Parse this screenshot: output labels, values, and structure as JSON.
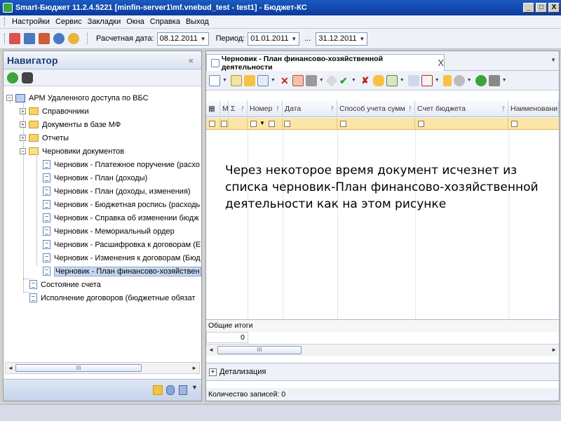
{
  "window": {
    "title": "Smart-Бюджет 11.2.4.5221 [minfin-server1\\mf.vnebud_test - test1] - Бюджет-КС",
    "minimize": "_",
    "maximize": "□",
    "close": "X"
  },
  "menu": [
    "Настройки",
    "Сервис",
    "Закладки",
    "Окна",
    "Справка",
    "Выход"
  ],
  "toolbar": {
    "calc_date_label": "Расчетная дата:",
    "calc_date_value": "08.12.2011",
    "period_label": "Период:",
    "period_from": "01.01.2011",
    "period_sep": "...",
    "period_to": "31.12.2011"
  },
  "navigator": {
    "title": "Навигатор",
    "collapse": "«",
    "tree": [
      {
        "label": "АРМ Удаленного доступа по ВБС",
        "level": 0,
        "icon": "pc",
        "expander": "−"
      },
      {
        "label": "Справочники",
        "level": 1,
        "icon": "folder",
        "expander": "+"
      },
      {
        "label": "Документы в базе МФ",
        "level": 1,
        "icon": "folder",
        "expander": "+"
      },
      {
        "label": "Отчеты",
        "level": 1,
        "icon": "folder",
        "expander": "+"
      },
      {
        "label": "Черновики документов",
        "level": 1,
        "icon": "folder-open",
        "expander": "−"
      },
      {
        "label": "Черновик - Платежное поручение (расхо",
        "level": 2,
        "icon": "doc"
      },
      {
        "label": "Черновик - План (доходы)",
        "level": 2,
        "icon": "doc"
      },
      {
        "label": "Черновик - План (доходы, изменения)",
        "level": 2,
        "icon": "doc"
      },
      {
        "label": "Черновик - Бюджетная роспись (расходь",
        "level": 2,
        "icon": "doc"
      },
      {
        "label": "Черновик - Справка об изменении бюдж",
        "level": 2,
        "icon": "doc"
      },
      {
        "label": "Черновик - Мемориальный ордер",
        "level": 2,
        "icon": "doc"
      },
      {
        "label": "Черновик - Расшифровка к договорам (Е",
        "level": 2,
        "icon": "doc"
      },
      {
        "label": "Черновик - Изменения к договорам (Бюд",
        "level": 2,
        "icon": "doc"
      },
      {
        "label": "Черновик - План финансово-хозяйствен",
        "level": 2,
        "icon": "doc",
        "selected": true
      },
      {
        "label": "Состояние счета",
        "level": 1,
        "icon": "doc"
      },
      {
        "label": "Исполнение договоров (бюджетные обязат",
        "level": 1,
        "icon": "doc"
      }
    ],
    "scroll_thumb": "III"
  },
  "document": {
    "tab_title": "Черновик - План финансово-хозяйственной деятельности",
    "tab_close": "X",
    "columns": [
      {
        "label": "М"
      },
      {
        "label": "Σ"
      },
      {
        "label": "Номер"
      },
      {
        "label": "Дата"
      },
      {
        "label": "Способ учета сумм"
      },
      {
        "label": "Счет бюджета"
      },
      {
        "label": "Наименовани"
      }
    ],
    "overlay_text": "Через некоторое время документ исчезнет из списка черновик-План финансово-хозяйственной деятельности как на этом рисунке",
    "totals_label": "Общие итоги",
    "totals_value": "0",
    "scroll_thumb": "III",
    "detail_label": "Детализация",
    "detail_toggle": "+",
    "records_label": "Количество записей: 0"
  },
  "colors": {
    "titlebar": "#0a3a9c",
    "filter_row": "#fbe6a8",
    "selected": "#c8d7f0"
  }
}
